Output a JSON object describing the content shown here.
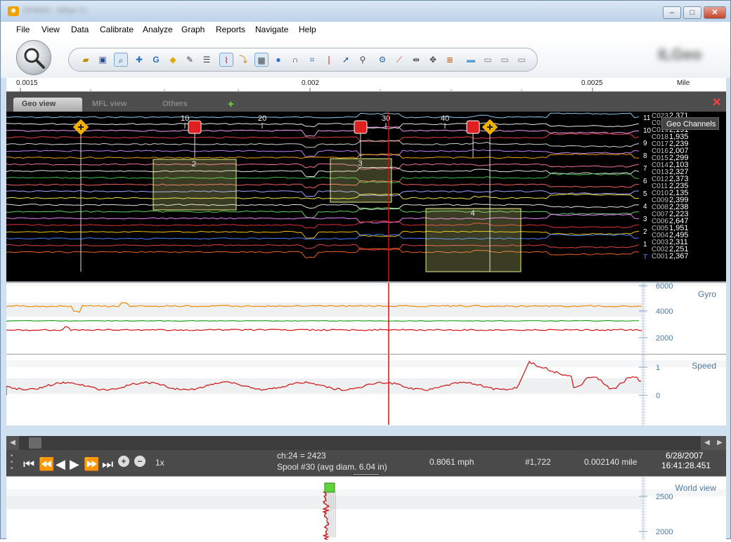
{
  "window": {
    "title": "DFMAS - GEye 4.0",
    "min_label": "–",
    "max_label": "□",
    "close_label": "✕",
    "app_icon": "app-icon"
  },
  "menu": [
    "File",
    "View",
    "Data",
    "Calibrate",
    "Analyze",
    "Graph",
    "Reports",
    "Navigate",
    "Help"
  ],
  "toolbar": {
    "icons": [
      "open-folder-icon",
      "save-icon",
      "zoom-icon",
      "add-marker-icon",
      "g-icon",
      "diamond-marker-icon",
      "pen-icon",
      "lines-icon",
      "chart-icon",
      "bend-icon",
      "grid-icon",
      "globe-icon",
      "magnet-icon",
      "crop-icon",
      "thermometer-icon",
      "arrow-icon",
      "pin-icon",
      "gear-icon",
      "ruler-icon",
      "scale-icon",
      "move-icon",
      "list-icon",
      "bar-icon",
      "chat-icon",
      "chat2-icon",
      "chat3-icon"
    ],
    "brand": "ILGeo"
  },
  "ruler": {
    "labels": [
      "0.0015",
      "0.002",
      "0.0025"
    ],
    "unit": "Mile"
  },
  "tabs": {
    "geo": "Geo view",
    "mfl": "MFL view",
    "others": "Others",
    "add": "+"
  },
  "geo": {
    "tooltip": "Geo Channels",
    "distance_marks": [
      "10",
      "20",
      "30",
      "40"
    ],
    "boxes": [
      "2",
      "3",
      "4"
    ],
    "sensors": [
      "11",
      "10",
      "9",
      "8",
      "7",
      "6",
      "5",
      "4",
      "3",
      "2",
      "1",
      "T"
    ],
    "channels": [
      {
        "name": "C023",
        "value": "2,371"
      },
      {
        "name": "C020",
        "value": "2,103"
      },
      {
        "name": "C019",
        "value": "2,191"
      },
      {
        "name": "C018",
        "value": "1,935"
      },
      {
        "name": "C017",
        "value": "2,239"
      },
      {
        "name": "C016",
        "value": "2,007"
      },
      {
        "name": "C015",
        "value": "2,299"
      },
      {
        "name": "C014",
        "value": "2,103"
      },
      {
        "name": "C013",
        "value": "2,327"
      },
      {
        "name": "C012",
        "value": "2,373"
      },
      {
        "name": "C011",
        "value": "2,235"
      },
      {
        "name": "C010",
        "value": "2,135"
      },
      {
        "name": "C009",
        "value": "2,399"
      },
      {
        "name": "C008",
        "value": "2,238"
      },
      {
        "name": "C007",
        "value": "2,223"
      },
      {
        "name": "C006",
        "value": "2,647"
      },
      {
        "name": "C005",
        "value": "1,951"
      },
      {
        "name": "C004",
        "value": "2,495"
      },
      {
        "name": "C003",
        "value": "2,311"
      },
      {
        "name": "C002",
        "value": "2,251"
      },
      {
        "name": "C001",
        "value": "2,367"
      }
    ]
  },
  "gyro": {
    "label": "Gyro",
    "ticks": [
      "6000",
      "4000",
      "2000"
    ]
  },
  "speed": {
    "label": "Speed",
    "ticks": [
      "1",
      "0"
    ]
  },
  "world": {
    "label": "World view",
    "ticks": [
      "2500",
      "2000"
    ]
  },
  "player": {
    "rate": "1x",
    "channel": "ch:24 = 2423",
    "spool": "Spool #30 (avg diam. 6.04 in)",
    "speed": "0.8061 mph",
    "record": "#1,722",
    "distance": "0.002140 mile",
    "date": "6/28/2007",
    "time": "16:41:28.451"
  },
  "colors": {
    "cursor": "#d01010",
    "box": "#e8f08a",
    "accent": "#5a8fbf"
  }
}
